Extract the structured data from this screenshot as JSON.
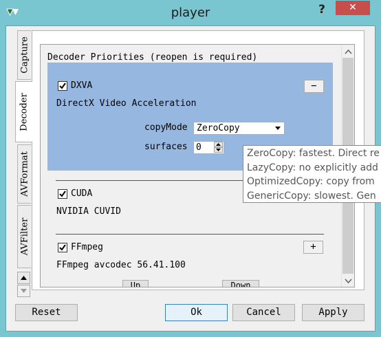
{
  "window": {
    "title": "player",
    "help_label": "?",
    "close_label": "✕",
    "icon": "app-logo-icon"
  },
  "tabs": [
    {
      "label": "Capture",
      "selected": false
    },
    {
      "label": "Decoder",
      "selected": true
    },
    {
      "label": "AVFormat",
      "selected": false
    },
    {
      "label": "AVFilter",
      "selected": false
    }
  ],
  "decoder": {
    "header": "Decoder Priorities (reopen is required)",
    "sections": [
      {
        "name": "DXVA",
        "checked": true,
        "button": "−",
        "description": "DirectX Video Acceleration",
        "options": {
          "copymode_label": "copyMode",
          "copymode_value": "ZeroCopy",
          "surfaces_label": "surfaces",
          "surfaces_value": "0"
        }
      },
      {
        "name": "CUDA",
        "checked": true,
        "description": "NVIDIA CUVID"
      },
      {
        "name": "FFmpeg",
        "checked": true,
        "button": "+",
        "description": "FFmpeg avcodec 56.41.100"
      }
    ],
    "up_label": "Up",
    "down_label": "Down"
  },
  "tooltip": {
    "lines": [
      "ZeroCopy: fastest. Direct re",
      "LazyCopy: no explicitly add",
      "OptimizedCopy: copy from",
      "GenericCopy: slowest. Gen"
    ]
  },
  "footer": {
    "reset": "Reset",
    "ok": "Ok",
    "cancel": "Cancel",
    "apply": "Apply"
  },
  "colors": {
    "titlebar": "#7ac6d0",
    "selection": "#96b8e0",
    "close": "#c74f4b"
  }
}
